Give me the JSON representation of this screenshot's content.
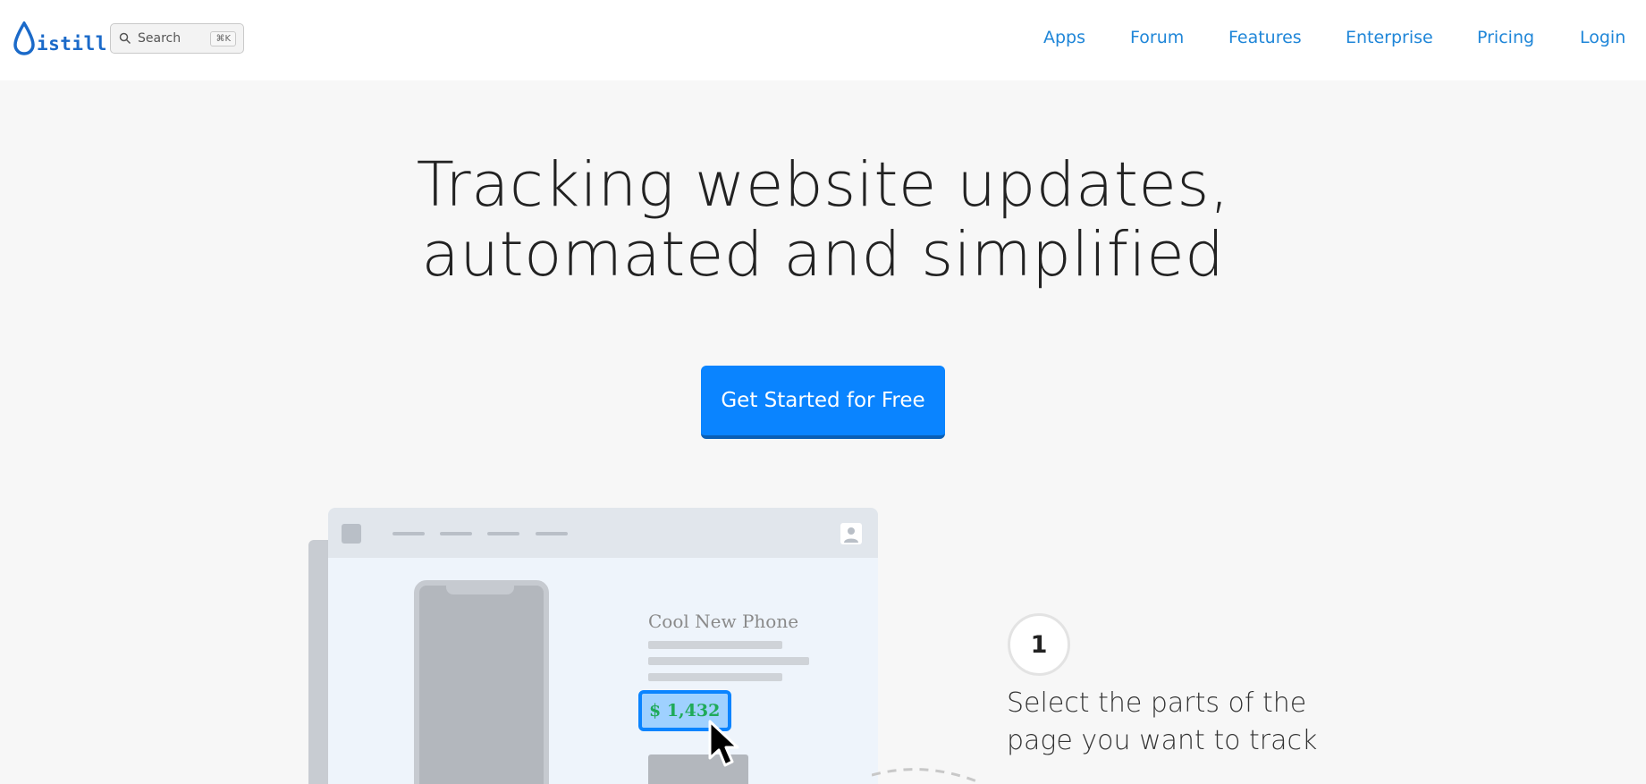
{
  "brand": {
    "logo_text": "istill"
  },
  "search": {
    "placeholder": "Search",
    "shortcut": "⌘K"
  },
  "nav": {
    "items": [
      {
        "label": "Apps"
      },
      {
        "label": "Forum"
      },
      {
        "label": "Features"
      },
      {
        "label": "Enterprise"
      },
      {
        "label": "Pricing"
      },
      {
        "label": "Login"
      }
    ]
  },
  "hero": {
    "headline_line1": "Tracking website updates,",
    "headline_line2": "automated and simplified",
    "cta_label": "Get Started for Free"
  },
  "illustration": {
    "product_title": "Cool New Phone",
    "price": "$ 1,432"
  },
  "step": {
    "number": "1",
    "text": "Select the parts of the page you want to track"
  },
  "colors": {
    "accent": "#0a84ff",
    "nav_link": "#1f86d8",
    "price_text": "#1faa59",
    "page_bg": "#f7f7f7"
  }
}
